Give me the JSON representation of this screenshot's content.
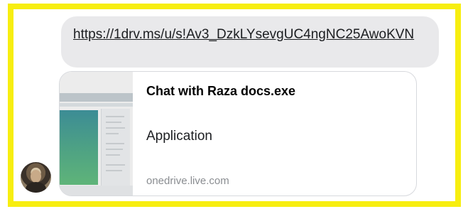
{
  "message": {
    "link_text": "https://1drv.ms/u/s!Av3_DzkLYsevgUC4ngNC25AwoKVN"
  },
  "preview_card": {
    "title": "Chat with Raza docs.exe",
    "subtitle": "Application",
    "domain": "onedrive.live.com",
    "thumbnail_icon": "document-thumbnail"
  },
  "sender": {
    "avatar_icon": "avatar-photo"
  },
  "colors": {
    "highlight_border": "#f7ee10",
    "bubble_bg": "#e9e9eb",
    "domain_text": "#8a8d91"
  }
}
